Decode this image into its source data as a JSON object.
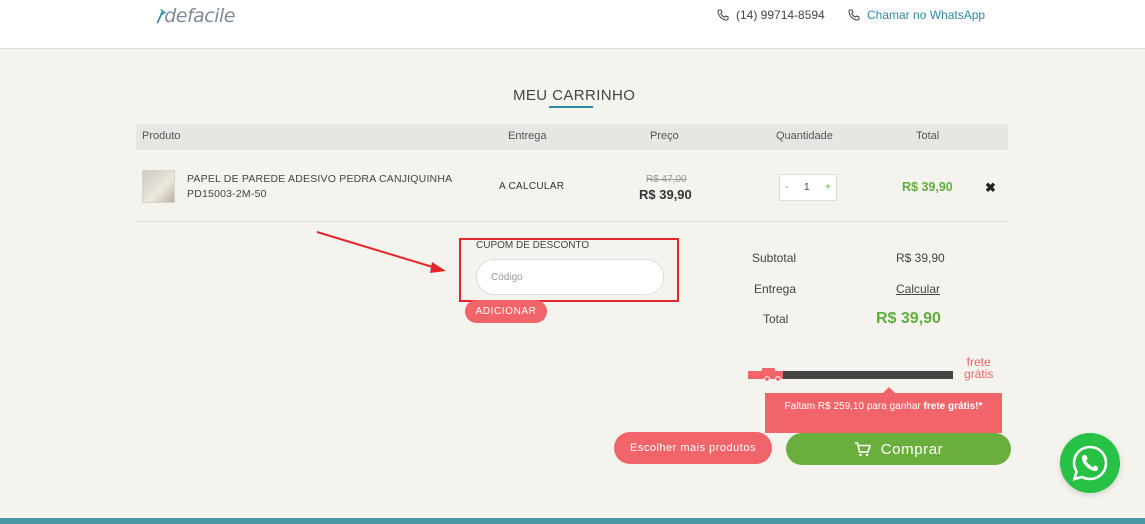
{
  "header": {
    "logo_text": "defacile",
    "phone": "(14) 99714-8594",
    "whatsapp_label": "Chamar no WhatsApp"
  },
  "page": {
    "title": "MEU CARRINHO"
  },
  "table": {
    "headers": [
      "Produto",
      "Entrega",
      "Preço",
      "Quantidade",
      "Total"
    ],
    "rows": [
      {
        "name_line1": "PAPEL DE PAREDE ADESIVO PEDRA CANJIQUINHA",
        "name_line2": "PD15003-2M-50",
        "delivery": "A CALCULAR",
        "old_price": "R$ 47,00",
        "price": "R$ 39,90",
        "qty_minus": "-",
        "quantity": "1",
        "qty_plus": "+",
        "total": "R$ 39,90",
        "remove": "✖"
      }
    ]
  },
  "coupon": {
    "label": "CUPOM DE DESCONTO",
    "placeholder": "Código",
    "button": "ADICIONAR"
  },
  "summary": {
    "subtotal_label": "Subtotal",
    "subtotal_value": "R$ 39,90",
    "delivery_label": "Entrega",
    "delivery_value": "Calcular",
    "total_label": "Total",
    "total_value": "R$ 39,90"
  },
  "freight": {
    "label_line1": "frete",
    "label_line2": "grátis",
    "progress": 0.17,
    "tooltip_prefix": "Faltam R$ 259,10 para ganhar ",
    "tooltip_bold": "frete grátis!*"
  },
  "actions": {
    "more_products": "Escolher mais produtos",
    "buy": "Comprar"
  },
  "colors": {
    "accent": "#2c8aa3",
    "coral": "#f0646a",
    "green": "#6aae3e",
    "annotation_red": "#e3262c"
  }
}
